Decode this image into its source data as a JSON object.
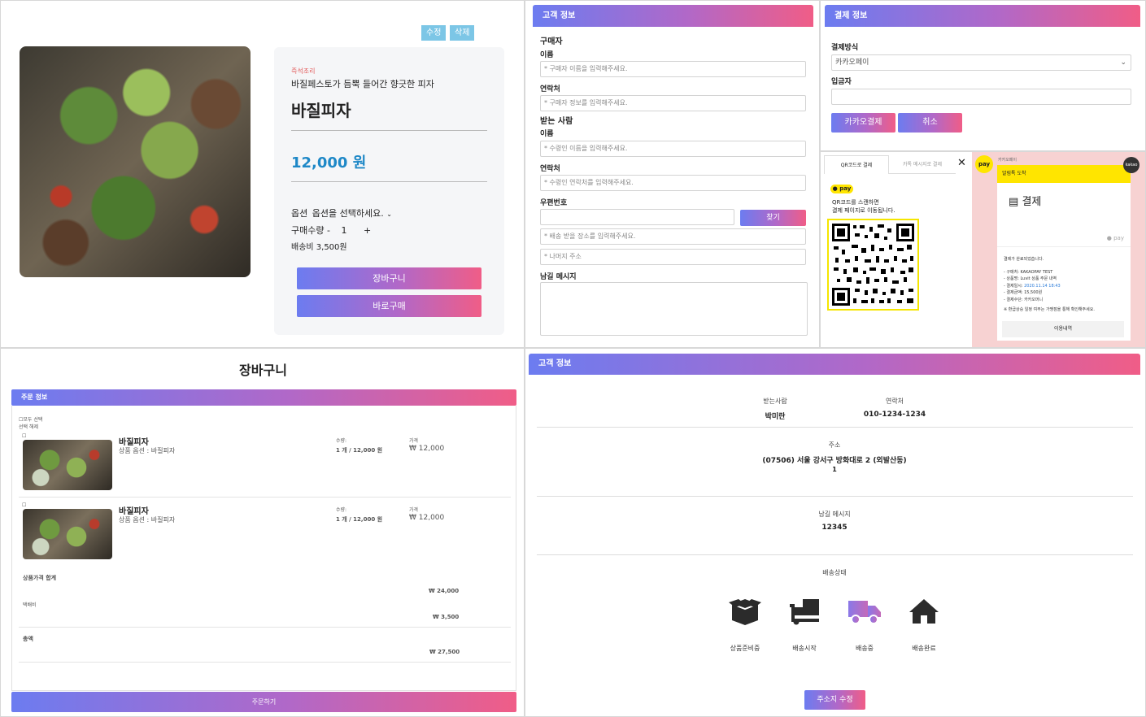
{
  "product": {
    "edit_label": "수정",
    "delete_label": "삭제",
    "tag": "즉석조리",
    "subtitle": "바질페스토가 듬뿍 들어간 향긋한 피자",
    "title": "바질피자",
    "price": "12,000 원",
    "option_label": "옵션",
    "option_placeholder": "옵션을 선택하세요.",
    "qty_label": "구매수량",
    "qty_minus": "-",
    "qty_value": "1",
    "qty_plus": "+",
    "shipping": "배송비 3,500원",
    "cart_button": "장바구니",
    "buy_button": "바로구매"
  },
  "customer_form": {
    "header": "고객 정보",
    "buyer_section": "구매자",
    "name_label": "이름",
    "name_placeholder": "* 구매자 이름을 입력해주세요.",
    "phone_label": "연락처",
    "phone_placeholder": "* 구매자 정보를 입력해주세요.",
    "receiver_section": "받는 사람",
    "receiver_name_label": "이름",
    "receiver_name_placeholder": "* 수령인 이름을 입력해주세요.",
    "receiver_phone_label": "연락처",
    "receiver_phone_placeholder": "* 수령인 연락처를 입력해주세요.",
    "zip_label": "우편번호",
    "find_button": "찾기",
    "address_placeholder": "* 배송 받을 장소를 입력해주세요.",
    "address_rest_placeholder": "* 나머지 주소",
    "message_label": "남길 메시지"
  },
  "payment": {
    "header": "결제 정보",
    "method_label": "결제방식",
    "method_value": "카카오페이",
    "depositor_label": "입금자",
    "kakao_button": "카카오결제",
    "cancel_button": "취소"
  },
  "kakao": {
    "tab_qr": "QR코드로 결제",
    "tab_msg": "카톡 메시지로 결제",
    "pay_badge": "pay",
    "scan_text_1": "QR코드를 스캔하면",
    "scan_text_2": "결제 페이지로 이동됩니다.",
    "top_small": "카카오페이",
    "notice": "알림톡 도착",
    "kakao_tag": "kakao",
    "pay_title": "결제",
    "pay_small": "pay",
    "body_1": "결제가 완료되었습니다.",
    "body_2": "- 구매처: KAKAOPAY TEST",
    "body_3": "- 상품명: Luvit 상품 주문 내역",
    "body_4_label": "- 결제일시:",
    "body_4_value": "2020.11.14 18:43",
    "body_5": "- 결제금액: 15,500원",
    "body_6": "- 결제수단: 카카오머니",
    "body_7": "※ 환급상승 일정 여부는 가맹점을 통해 확인해주세요.",
    "history_button": "이용내역"
  },
  "cart": {
    "title": "장바구니",
    "header": "주문 정보",
    "select_all": "모두 선택",
    "select_none": "선택 해제",
    "items": [
      {
        "name": "바질피자",
        "option": "상품 옵션 : 바질피자",
        "qty_label": "수량:",
        "qty_value": "1 개 / 12,000 원",
        "price_label": "가격",
        "price": "₩ 12,000"
      },
      {
        "name": "바질피자",
        "option": "상품 옵션 : 바질피자",
        "qty_label": "수량:",
        "qty_value": "1 개 / 12,000 원",
        "price_label": "가격",
        "price": "₩ 12,000"
      }
    ],
    "subtotal_label": "상품가격 합계",
    "subtotal": "₩ 24,000",
    "shipping_label": "택배비",
    "shipping": "₩ 3,500",
    "total_label": "총액",
    "total": "₩ 27,500",
    "order_button": "주문하기"
  },
  "delivery": {
    "header": "고객 정보",
    "receiver_label": "받는사람",
    "receiver_value": "박미란",
    "phone_label": "연락처",
    "phone_value": "010-1234-1234",
    "address_label": "주소",
    "address_value": "(07506) 서울 강서구 방화대로 2 (외발산동)",
    "address_detail": "1",
    "message_label": "남길 메시지",
    "message_value": "12345",
    "status_label": "배송상태",
    "statuses": [
      {
        "label": "상품준비중",
        "icon": "box-icon"
      },
      {
        "label": "배송시작",
        "icon": "dolly-icon"
      },
      {
        "label": "배송중",
        "icon": "truck-icon"
      },
      {
        "label": "배송완료",
        "icon": "home-icon"
      }
    ],
    "edit_address_button": "주소지 수정"
  },
  "colors": {
    "gradient_start": "#6c7cf0",
    "gradient_end": "#f05d87",
    "price_blue": "#1e88c7",
    "kakao_yellow": "#ffe500",
    "edit_blue": "#7cc6e6"
  }
}
